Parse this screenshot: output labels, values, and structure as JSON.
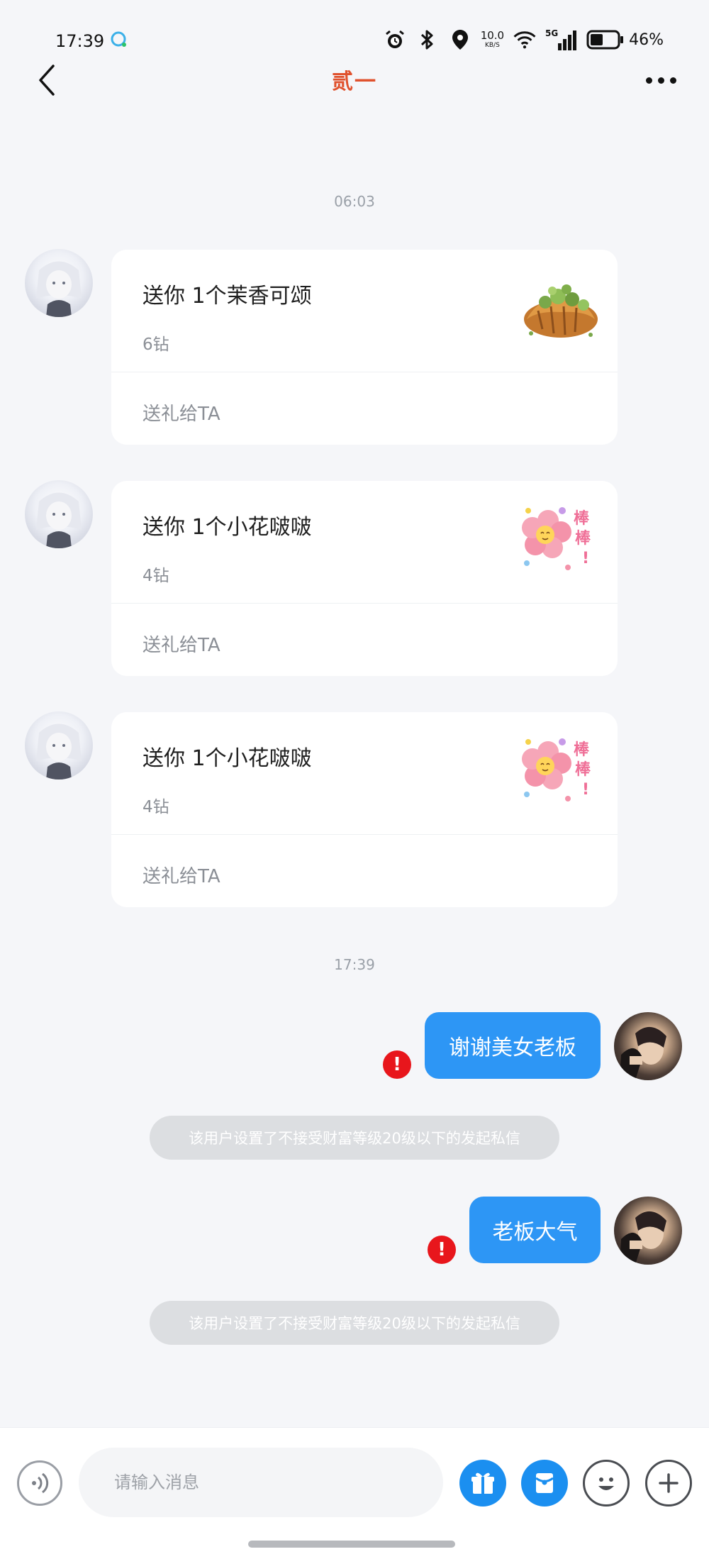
{
  "status_bar": {
    "time": "17:39",
    "net_speed_value": "10.0",
    "net_speed_unit": "KB/S",
    "network": "5G",
    "battery_percent": "46%",
    "battery_level": 0.46,
    "icons": [
      "alarm-icon",
      "bluetooth-icon",
      "location-icon",
      "wifi-icon",
      "signal-icon",
      "battery-icon"
    ]
  },
  "header": {
    "title": "贰一",
    "title_color": "#e0522e"
  },
  "messages": {
    "timestamp_1": "06:03",
    "gift_1": {
      "title": "送你  1个茉香可颂",
      "price": "6钻",
      "action": "送礼给TA",
      "gift_icon": "croissant"
    },
    "gift_2": {
      "title": "送你  1个小花啵啵",
      "price": "4钻",
      "action": "送礼给TA",
      "gift_icon": "flower-bobo"
    },
    "gift_3": {
      "title": "送你  1个小花啵啵",
      "price": "4钻",
      "action": "送礼给TA",
      "gift_icon": "flower-bobo"
    },
    "timestamp_2": "17:39",
    "out_1": {
      "text": "谢谢美女老板",
      "error_mark": "!"
    },
    "notice_1": "该用户设置了不接受财富等级20级以下的发起私信",
    "out_2": {
      "text": "老板大气",
      "error_mark": "!"
    },
    "notice_2": "该用户设置了不接受财富等级20级以下的发起私信"
  },
  "input_bar": {
    "placeholder": "请输入消息",
    "tools": [
      "voice-icon",
      "gift-icon",
      "red-packet-icon",
      "emoji-icon",
      "plus-icon"
    ],
    "accent_color": "#1b8ff0"
  },
  "colors": {
    "bubble_out": "#2d96f5",
    "error": "#e8161c",
    "background": "#f5f6f9"
  }
}
